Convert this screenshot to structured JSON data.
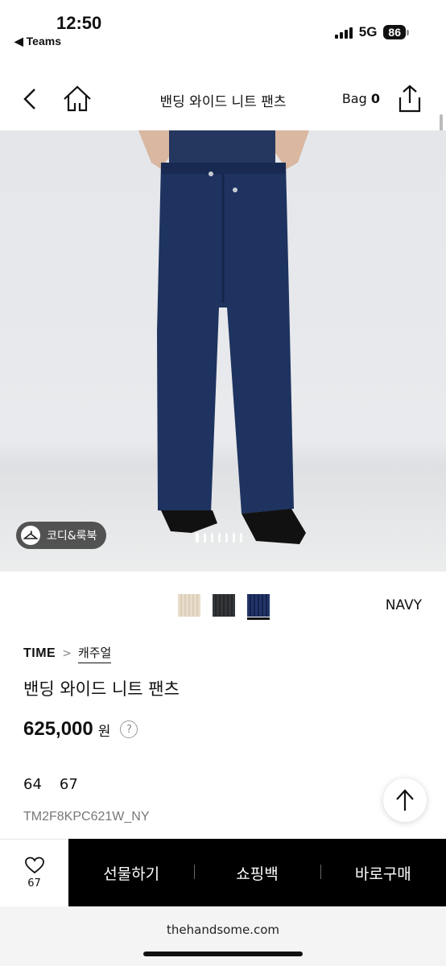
{
  "status": {
    "time": "12:50",
    "back_app": "◀ Teams",
    "network": "5G",
    "battery": "86"
  },
  "nav": {
    "title": "밴딩 와이드 니트 팬츠",
    "bag_label": "Bag",
    "bag_count": "0",
    "icons": [
      "chevron-left-icon",
      "home-icon",
      "share-icon"
    ]
  },
  "gallery": {
    "codi_label": "코디&룩북",
    "page_count": 7,
    "current_page": 1
  },
  "colors": {
    "selected_name": "NAVY",
    "swatches": [
      {
        "name": "beige",
        "hex": "#e6d9c8"
      },
      {
        "name": "charcoal",
        "hex": "#2f3133"
      },
      {
        "name": "navy",
        "hex": "#1c2c5a",
        "selected": true
      }
    ]
  },
  "product": {
    "brand": "TIME",
    "category": "캐주얼",
    "title": "밴딩 와이드 니트 팬츠",
    "price": "625,000",
    "currency": "원",
    "help": "?",
    "sizes": [
      "64",
      "67"
    ],
    "code": "TM2F8KPC621W_NY"
  },
  "bottom_bar": {
    "like_count": "67",
    "actions": [
      "선물하기",
      "쇼핑백",
      "바로구매"
    ]
  },
  "browser": {
    "url": "thehandsome.com"
  },
  "theme": {
    "pants": "#1e3360",
    "accent": "#000000"
  }
}
